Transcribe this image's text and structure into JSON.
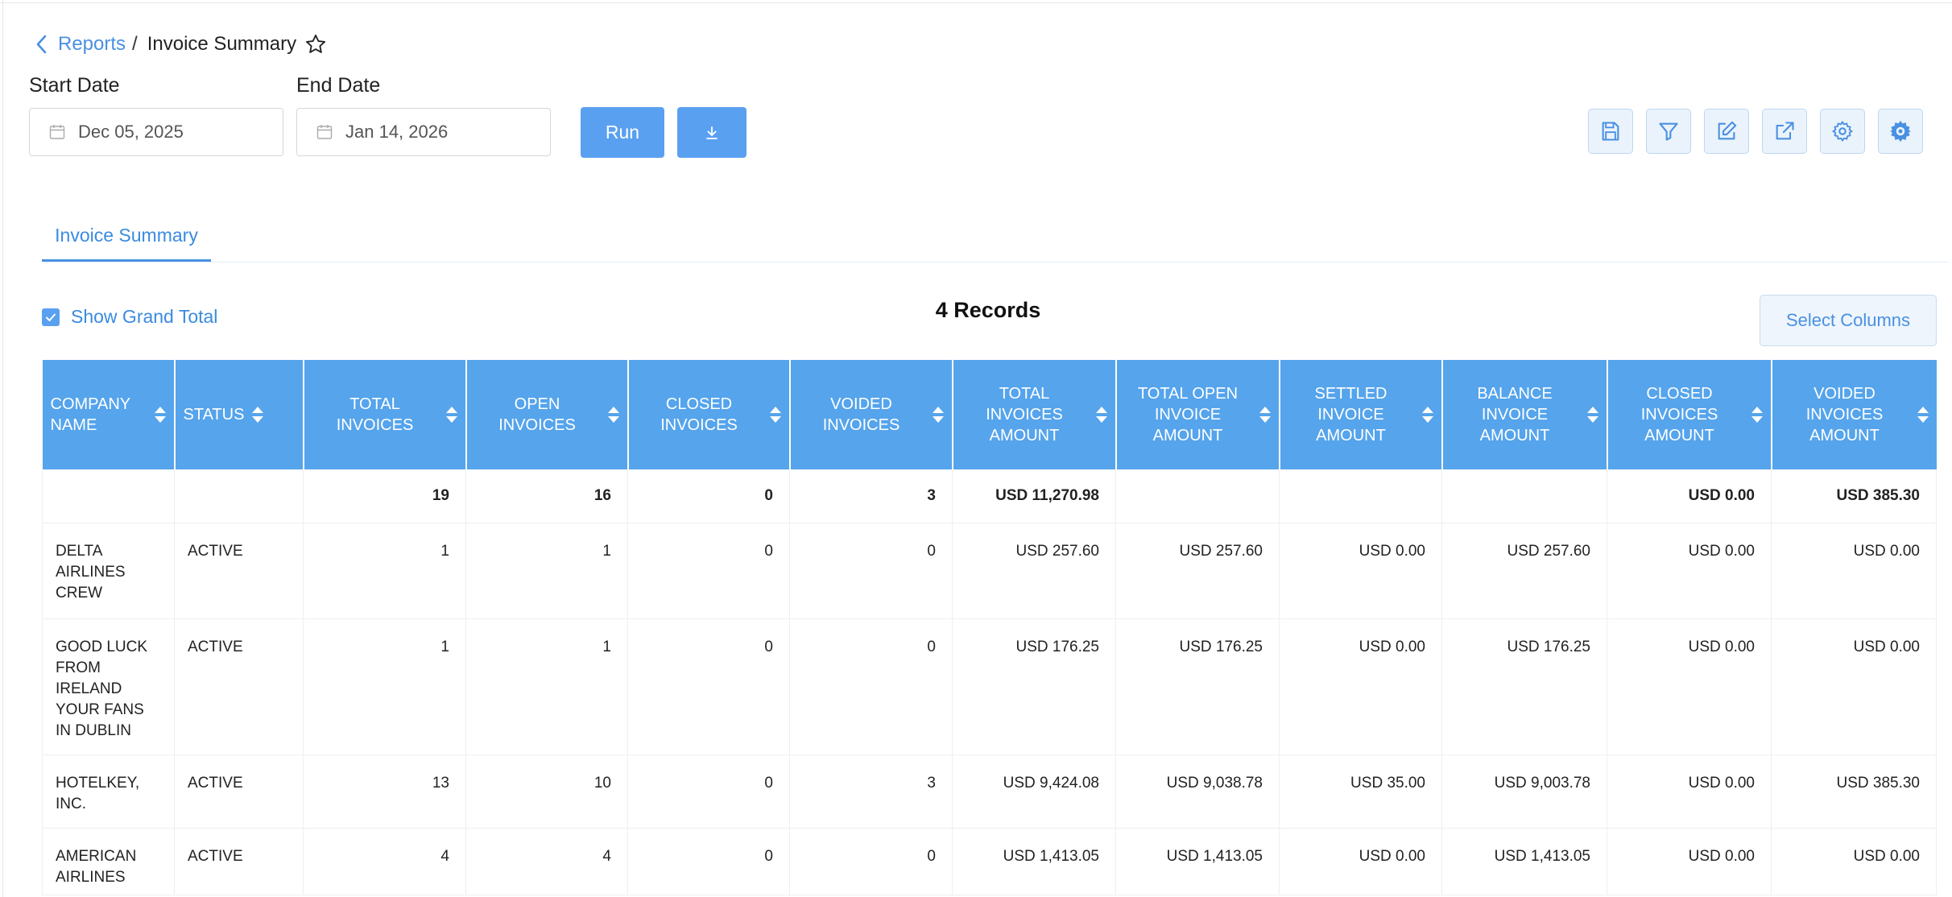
{
  "breadcrumb": {
    "parent": "Reports",
    "separator": "/",
    "current": "Invoice Summary"
  },
  "filters": {
    "start_label": "Start Date",
    "start_value": "Dec 05, 2025",
    "end_label": "End Date",
    "end_value": "Jan 14, 2026"
  },
  "actions": {
    "run_label": "Run"
  },
  "toolbar_icons": [
    "save-icon",
    "filter-icon",
    "edit-icon",
    "external-link-icon",
    "settings-icon",
    "config-gear-icon"
  ],
  "tabs": [
    {
      "label": "Invoice Summary",
      "active": true
    }
  ],
  "grand_total": {
    "label": "Show Grand Total",
    "checked": true
  },
  "records_label": "4 Records",
  "select_columns_label": "Select Columns",
  "colors": {
    "accent": "#55a4ec",
    "button": "#5aa0f0",
    "link": "#4a90e2"
  },
  "table": {
    "columns": [
      "COMPANY NAME",
      "STATUS",
      "TOTAL INVOICES",
      "OPEN INVOICES",
      "CLOSED INVOICES",
      "VOIDED INVOICES",
      "TOTAL INVOICES AMOUNT",
      "TOTAL OPEN INVOICE AMOUNT",
      "SETTLED INVOICE AMOUNT",
      "BALANCE INVOICE AMOUNT",
      "CLOSED INVOICES AMOUNT",
      "VOIDED INVOICES AMOUNT"
    ],
    "totals": [
      "",
      "",
      "19",
      "16",
      "0",
      "3",
      "USD 11,270.98",
      "",
      "",
      "",
      "USD 0.00",
      "USD 385.30"
    ],
    "rows": [
      [
        "DELTA AIRLINES CREW",
        "ACTIVE",
        "1",
        "1",
        "0",
        "0",
        "USD 257.60",
        "USD 257.60",
        "USD 0.00",
        "USD 257.60",
        "USD 0.00",
        "USD 0.00"
      ],
      [
        "GOOD LUCK FROM IRELAND YOUR FANS IN DUBLIN",
        "ACTIVE",
        "1",
        "1",
        "0",
        "0",
        "USD 176.25",
        "USD 176.25",
        "USD 0.00",
        "USD 176.25",
        "USD 0.00",
        "USD 0.00"
      ],
      [
        "HOTELKEY, INC.",
        "ACTIVE",
        "13",
        "10",
        "0",
        "3",
        "USD 9,424.08",
        "USD 9,038.78",
        "USD 35.00",
        "USD 9,003.78",
        "USD 0.00",
        "USD 385.30"
      ],
      [
        "AMERICAN AIRLINES",
        "ACTIVE",
        "4",
        "4",
        "0",
        "0",
        "USD 1,413.05",
        "USD 1,413.05",
        "USD 0.00",
        "USD 1,413.05",
        "USD 0.00",
        "USD 0.00"
      ]
    ]
  }
}
